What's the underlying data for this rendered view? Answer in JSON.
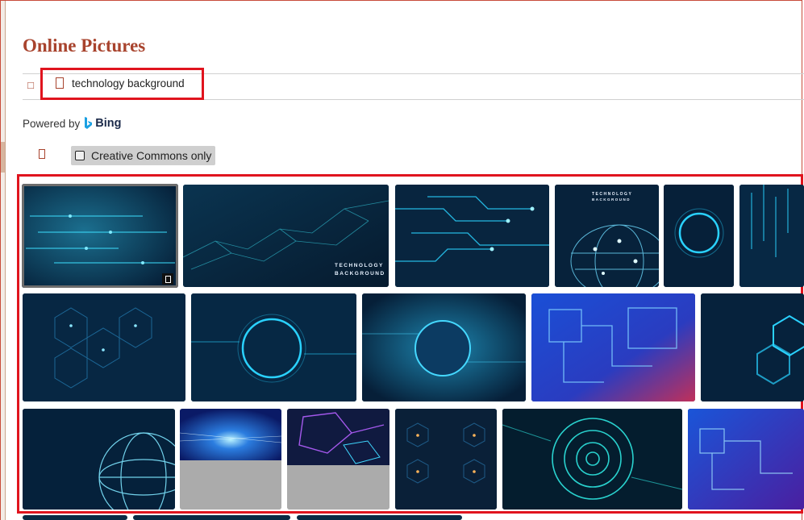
{
  "dialog": {
    "title": "Online Pictures"
  },
  "search": {
    "query": "technology background"
  },
  "provider": {
    "powered_by_label": "Powered by",
    "brand": "Bing"
  },
  "filters": {
    "creative_commons_label": "Creative Commons only",
    "creative_commons_checked": false
  },
  "results": {
    "thumbnails": [
      {
        "name": "result-1",
        "selected": true
      },
      {
        "name": "result-2",
        "caption_line1": "TECHNOLOGY",
        "caption_line2": "BACKGROUND"
      },
      {
        "name": "result-3"
      },
      {
        "name": "result-4",
        "caption_line1": "TECHNOLOGY",
        "caption_line2": "BACKGROUND"
      },
      {
        "name": "result-5"
      },
      {
        "name": "result-6"
      },
      {
        "name": "result-7"
      },
      {
        "name": "result-8"
      },
      {
        "name": "result-9"
      },
      {
        "name": "result-10"
      },
      {
        "name": "result-11"
      },
      {
        "name": "result-12"
      },
      {
        "name": "result-13"
      },
      {
        "name": "result-14"
      },
      {
        "name": "result-15"
      },
      {
        "name": "result-16"
      },
      {
        "name": "result-17"
      }
    ]
  },
  "colors": {
    "accent": "#a8432d",
    "highlight_frame": "#e0141e",
    "thumb_dark": "#0b2a4a",
    "thumb_cyan": "#2ad2ff"
  },
  "icons": {
    "back": "back-arrow-icon",
    "search": "search-icon",
    "filter": "filter-icon",
    "bing": "bing-logo-icon"
  }
}
